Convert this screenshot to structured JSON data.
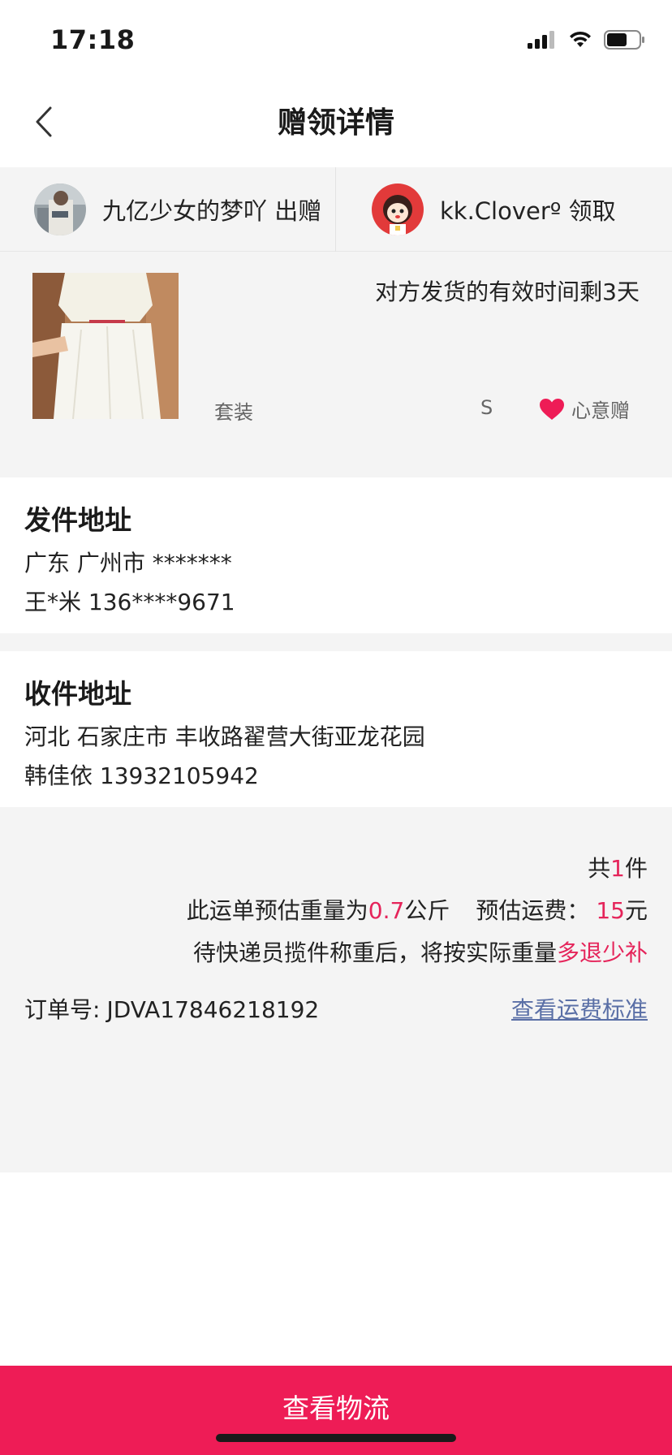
{
  "status_bar": {
    "time": "17:18"
  },
  "nav": {
    "title": "赠领详情"
  },
  "gift": {
    "sender": {
      "name": "九亿少女的梦吖",
      "action": "出赠"
    },
    "receiver": {
      "name": "kk.Cloverº",
      "action": "领取"
    },
    "deadline": "对方发货的有效时间剩3天",
    "item_name": "套装",
    "size": "S",
    "gift_type": "心意赠"
  },
  "send_address": {
    "title": "发件地址",
    "location": "广东 广州市 *******",
    "contact": "王*米 136****9671"
  },
  "receive_address": {
    "title": "收件地址",
    "location": "河北 石家庄市 丰收路翟营大街亚龙花园",
    "contact": "韩佳依 13932105942"
  },
  "summary": {
    "count_prefix": "共",
    "count": "1",
    "count_suffix": "件",
    "weight_prefix": "此运单预估重量为",
    "weight": "0.7",
    "weight_unit": "公斤",
    "fee_label": "预估运费：",
    "fee": "15",
    "fee_unit": "元",
    "note_prefix": "待快递员揽件称重后，将按实际重量",
    "note_highlight": "多退少补",
    "order_label": "订单号:",
    "order_no": "JDVA17846218192",
    "fee_link": "查看运费标准"
  },
  "bottom_button": {
    "label": "查看物流"
  },
  "colors": {
    "accent": "#ee1c56",
    "highlight": "#e5245a",
    "link": "#5a6fa6",
    "background": "#f4f4f4"
  }
}
